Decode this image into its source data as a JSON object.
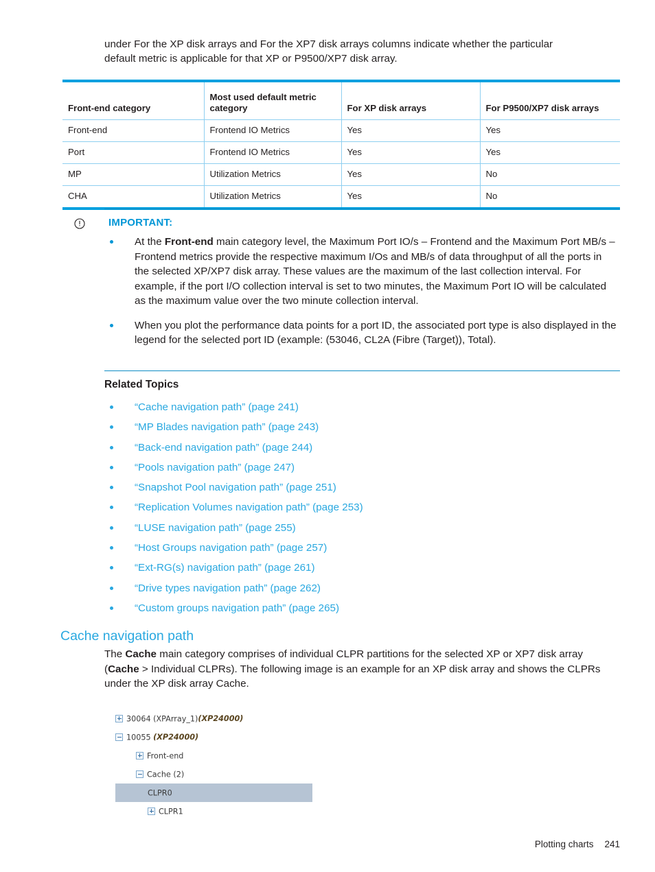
{
  "colors": {
    "brand_blue": "#0096d6",
    "link_blue": "#29a8e0",
    "table_rule": "#00a0df",
    "table_grid": "#8ecff0",
    "tree_select": "#b6c4d4",
    "tree_model_text": "#5a4520"
  },
  "intro": {
    "text": "under For the XP disk arrays and For the XP7 disk arrays columns indicate whether the particular default metric is applicable for that XP or P9500/XP7 disk array."
  },
  "table": {
    "headers": [
      "Front-end category",
      "Most used default metric category",
      "For XP disk arrays",
      "For P9500/XP7 disk arrays"
    ],
    "rows": [
      [
        "Front-end",
        "Frontend IO Metrics",
        "Yes",
        "Yes"
      ],
      [
        "Port",
        "Frontend IO Metrics",
        "Yes",
        "Yes"
      ],
      [
        "MP",
        "Utilization Metrics",
        "Yes",
        "No"
      ],
      [
        "CHA",
        "Utilization Metrics",
        "Yes",
        "No"
      ]
    ]
  },
  "important": {
    "icon": "exclamation-circle-icon",
    "title": "IMPORTANT:",
    "items": [
      {
        "html": "At the <b>Front-end</b> main category level, the Maximum Port IO/s &ndash; Frontend and the Maximum Port MB/s &ndash; Frontend metrics provide the respective maximum I/Os and MB/s of data throughput of all the ports in the selected XP/XP7 disk array. These values are the maximum of the last collection interval. For example, if the port I/O collection interval is set to two minutes, the Maximum Port IO will be calculated as the maximum value over the two minute collection interval."
      },
      {
        "html": "When you plot the performance data points for a port ID, the associated port type is also displayed in the legend for the selected port ID (example: (53046, CL2A (Fibre (Target)), Total)."
      }
    ]
  },
  "related": {
    "title": "Related Topics",
    "links": [
      "“Cache navigation path” (page 241)",
      "“MP Blades navigation path” (page 243)",
      "“Back-end navigation path” (page 244)",
      "“Pools navigation path” (page 247)",
      "“Snapshot Pool navigation path” (page 251)",
      "“Replication Volumes navigation path” (page 253)",
      "“LUSE navigation path” (page 255)",
      "“Host Groups navigation path” (page 257)",
      "“Ext-RG(s) navigation path” (page 261)",
      "“Drive types navigation path” (page 262)",
      "“Custom groups navigation path” (page 265)"
    ]
  },
  "cache_section": {
    "heading": "Cache navigation path",
    "paragraph_html": "The <b>Cache</b> main category comprises of individual CLPR partitions for the selected XP or XP7 disk array (<b>Cache</b> &gt; Individual CLPRs). The following image is an example for an XP disk array and shows the CLPRs under the XP disk array Cache."
  },
  "tree": {
    "rows": [
      {
        "indent": 1,
        "toggle": "plus",
        "label": "30064 (XPArray_1)",
        "model": "(XP24000)",
        "selected": false
      },
      {
        "indent": 1,
        "toggle": "minus",
        "label": "10055 ",
        "model": "(XP24000)",
        "selected": false
      },
      {
        "indent": 2,
        "toggle": "plus",
        "label": "Front-end",
        "model": "",
        "selected": false
      },
      {
        "indent": 2,
        "toggle": "minus",
        "label": "Cache (2)",
        "model": "",
        "selected": false
      },
      {
        "indent": 3,
        "toggle": "none",
        "label": "CLPR0",
        "model": "",
        "selected": true
      },
      {
        "indent": 3,
        "toggle": "plus",
        "label": "CLPR1",
        "model": "",
        "selected": false
      }
    ]
  },
  "footer": {
    "chapter": "Plotting charts",
    "page_number": "241"
  }
}
